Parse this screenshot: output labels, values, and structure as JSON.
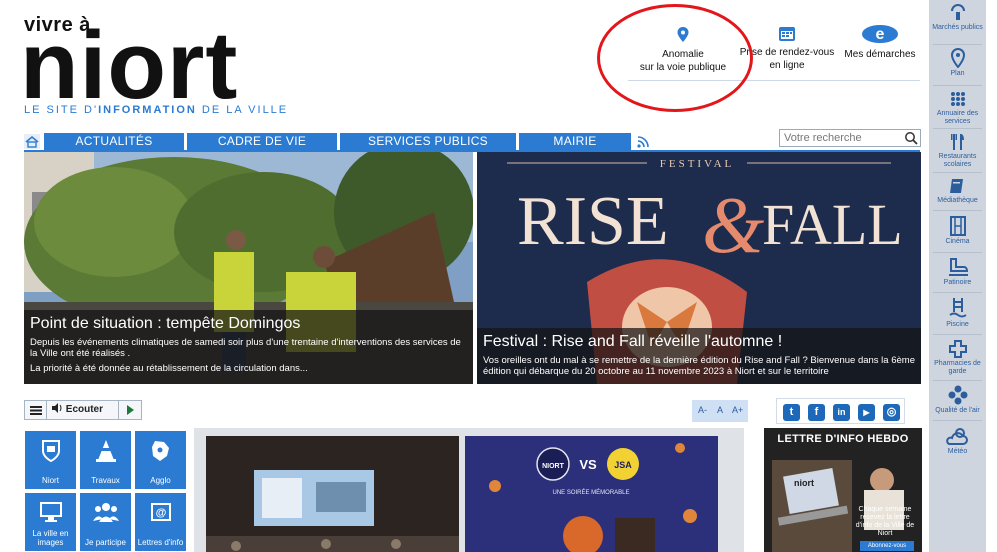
{
  "header": {
    "logo_small": "vivre à",
    "logo_big": "niort",
    "tagline_parts": [
      "LE SITE ",
      "D'",
      "INFORMATION",
      " DE LA VILLE"
    ]
  },
  "quick_links": [
    {
      "label_line1": "Anomalie",
      "label_line2": "sur la voie publique",
      "icon": "location-pin-icon"
    },
    {
      "label_line1": "Prise de rendez-vous",
      "label_line2": "en ligne",
      "icon": "calendar-icon"
    },
    {
      "label_line1": "Mes démarches",
      "label_line2": "",
      "icon": "e-services-icon"
    }
  ],
  "sidebar": [
    {
      "label": "Marchés publics",
      "icon": "market-icon"
    },
    {
      "label": "Plan",
      "icon": "map-pin-icon"
    },
    {
      "label": "Annuaire des services",
      "icon": "directory-icon"
    },
    {
      "label": "Restaurants scolaires",
      "icon": "cutlery-icon"
    },
    {
      "label": "Médiathèque",
      "icon": "book-icon"
    },
    {
      "label": "Cinéma",
      "icon": "film-icon"
    },
    {
      "label": "Patinoire",
      "icon": "skate-icon"
    },
    {
      "label": "Piscine",
      "icon": "pool-icon"
    },
    {
      "label": "Pharmacies de garde",
      "icon": "pharmacy-cross-icon"
    },
    {
      "label": "Qualité de l'air",
      "icon": "air-quality-icon"
    },
    {
      "label": "Météo",
      "icon": "weather-icon"
    }
  ],
  "nav": {
    "items": [
      "ACTUALITÉS",
      "CADRE DE VIE",
      "SERVICES PUBLICS",
      "MAIRIE"
    ],
    "search_placeholder": "Votre recherche"
  },
  "hero": [
    {
      "title": "Point de situation : tempête Domingos",
      "text1": "Depuis les événements climatiques de samedi soir plus d'une trentaine d'interventions des services de la Ville ont été réalisés .",
      "text2": "La priorité à été donnée au rétablissement de la circulation dans..."
    },
    {
      "poster_small": "FESTIVAL",
      "poster_big_left": "RISE",
      "poster_amp": "&",
      "poster_big_right": "FALL",
      "title": "Festival : Rise and Fall réveille l'automne !",
      "text1": "Vos oreilles ont du mal à se remettre de la dernière édition du Rise and Fall ? Bienvenue dans la 6ème édition qui débarque du 20 octobre au 11 novembre 2023 à Niort et sur le territoire"
    }
  ],
  "tools": {
    "listen_label": "Ecouter",
    "font_sizes": [
      "A-",
      "A",
      "A+"
    ]
  },
  "socials": [
    {
      "name": "twitter-icon",
      "glyph": "t"
    },
    {
      "name": "facebook-icon",
      "glyph": "f"
    },
    {
      "name": "linkedin-icon",
      "glyph": "in"
    },
    {
      "name": "youtube-icon",
      "glyph": "▶"
    },
    {
      "name": "instagram-icon",
      "glyph": "◎"
    }
  ],
  "tiles": [
    {
      "label": "Niort",
      "icon": "crest-icon"
    },
    {
      "label": "Travaux",
      "icon": "cone-icon"
    },
    {
      "label": "Agglo",
      "icon": "map-region-icon"
    },
    {
      "label": "La ville en images",
      "icon": "monitor-icon"
    },
    {
      "label": "Je participe",
      "icon": "people-icon"
    },
    {
      "label": "Lettres d'info",
      "icon": "newsletter-icon"
    }
  ],
  "media": {
    "match_left": "NIORT",
    "match_vs": "VS",
    "match_right": "JSA",
    "match_tag": "UNE SOIRÉE MÉMORABLE"
  },
  "newsletter": {
    "heading": "LETTRE D'INFO HEBDO",
    "laptop_text": "niort",
    "text": "Chaque semaine recevez la lettre d'info de la Ville de Niort",
    "button": "Abonnez-vous"
  },
  "colors": {
    "brand_blue": "#2a7bd1",
    "annotation_red": "#e3161b",
    "sidebar_bg": "#cfd5de"
  }
}
